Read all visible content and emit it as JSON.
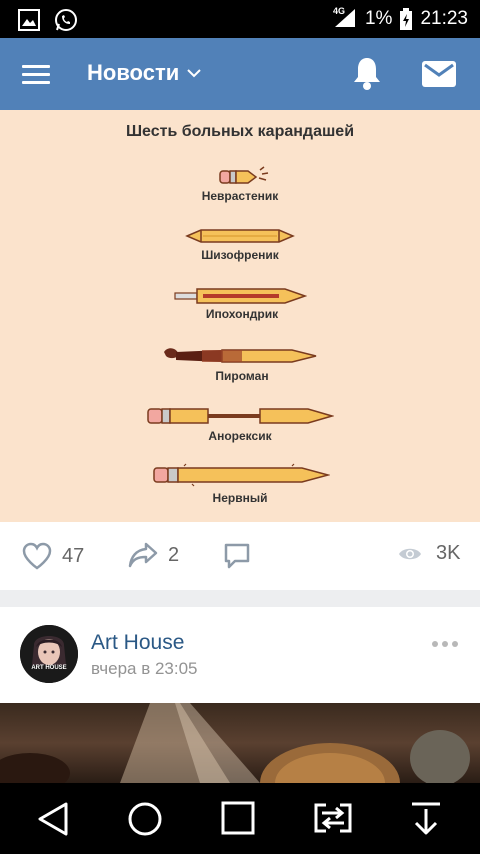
{
  "status_bar": {
    "network": "4G",
    "battery": "1%",
    "time": "21:23"
  },
  "app_bar": {
    "title": "Новости"
  },
  "post1": {
    "image": {
      "title": "Шесть больных карандашей",
      "labels": [
        "Неврастеник",
        "Шизофреник",
        "Ипохондрик",
        "Пироман",
        "Анорексик",
        "Нервный"
      ]
    },
    "likes": "47",
    "shares": "2",
    "views": "3K"
  },
  "post2": {
    "author": "Art House",
    "time": "вчера в 23:05",
    "avatar_text": "ART HOUSE"
  },
  "colors": {
    "accent": "#5181b8",
    "link": "#2a5885",
    "pencil_yellow": "#f5c15a",
    "pencil_outline": "#7a3b1e"
  }
}
